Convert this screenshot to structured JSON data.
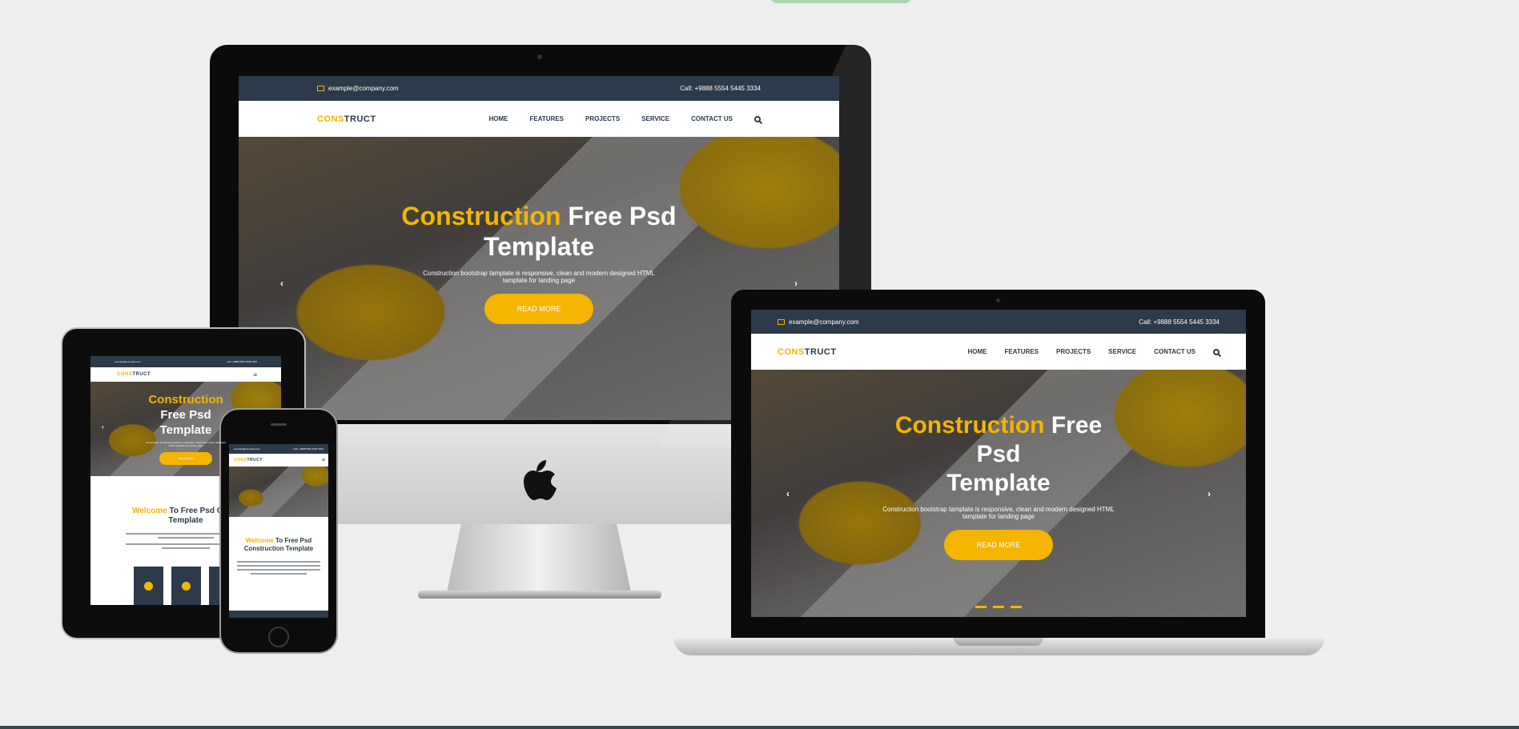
{
  "site": {
    "email": "example@company.com",
    "phone": "Call: +9888 5554 5445 3334",
    "logo_highlight": "CONS",
    "logo_rest": "TRUCT",
    "nav": [
      "HOME",
      "FEATURES",
      "PROJECTS",
      "SERVICE",
      "CONTACT US"
    ],
    "hero": {
      "title_highlight": "Construction",
      "title_rest": "Free Psd",
      "title_line2": "Template",
      "subtitle": "Construction bootstrap tamplate is responsive, clean and modern designed HTML tamplate for landing page",
      "button": "READ MORE"
    },
    "welcome": {
      "highlight": "Welcome",
      "rest": "To Free Psd",
      "line2": "Construction Template",
      "ipad_rest": "To Free Psd Const",
      "ipad_line2": "Template"
    }
  },
  "icons": {
    "mail": "envelope-icon",
    "search": "search-icon",
    "menu": "hamburger-icon",
    "prev": "chevron-left-icon",
    "next": "chevron-right-icon",
    "apple": "apple-logo"
  },
  "colors": {
    "accent": "#f4b400",
    "dark": "#2c3a4a",
    "background": "#eeeeee"
  }
}
